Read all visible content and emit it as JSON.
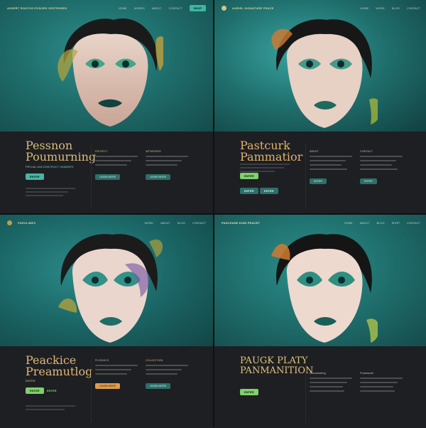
{
  "panels": [
    {
      "nav": {
        "brand": "ASSERT ROUTOS POSORS VESTRORES",
        "links": [
          "HOME",
          "WORKS",
          "ABOUT",
          "CONTACT"
        ],
        "cta": "SHOP"
      },
      "title": "Pessnon Poumurning",
      "subtitle": "PROJAL ANCONSTRUCT HANDRES",
      "button_primary": "ENTER",
      "columns": [
        {
          "heading": "PROJECT",
          "button": "LEARN MORE"
        },
        {
          "heading": "ARTWORKS",
          "button": "LEARN MORE"
        }
      ],
      "colors": {
        "accent": "#49b4a3",
        "gold": "#d8bd7a"
      }
    },
    {
      "nav": {
        "brand": "AURIEL  SIGNATURE  PEACE",
        "links": [
          "HOME",
          "WORK",
          "BLOG",
          "CONTACT"
        ],
        "cta": ""
      },
      "title": "Pastcurk Pammatior",
      "subtitle": "",
      "button_primary": "ENTER",
      "button_secondary": "ENTER",
      "columns": [
        {
          "heading": "ABOUT",
          "button": "ENTER"
        },
        {
          "heading": "CONTACT",
          "button": "ENTER"
        }
      ],
      "colors": {
        "accent": "#49b4a3",
        "gold": "#d8bd7a"
      }
    },
    {
      "nav": {
        "brand": "PAROLIMES",
        "links": [
          "WORK",
          "ABOUT",
          "BLOG",
          "CONTACT"
        ],
        "cta": ""
      },
      "title": "Peackice Preamutlog",
      "subtitle": "ENTER",
      "button_primary": "ENTER",
      "button_secondary": "ENTER",
      "columns": [
        {
          "heading": "PLODNICS",
          "button": "LEARN MORE"
        },
        {
          "heading": "COLLECTION",
          "button": "LEARN MORE"
        }
      ],
      "colors": {
        "accent": "#7fd06e",
        "gold": "#d8bd7a",
        "orange": "#e09a4a"
      }
    },
    {
      "nav": {
        "brand": "PAGLEASE KOIN  PEACET",
        "links": [
          "HOME",
          "ABOUT",
          "BLOG",
          "SHOP",
          "CONTACT"
        ],
        "cta": ""
      },
      "title": "PAUGK PLATY PANMANITION",
      "subtitle": "",
      "button_primary": "ENTER",
      "columns": [
        {
          "heading": "Documenting",
          "button": ""
        },
        {
          "heading": "Framework",
          "button": ""
        }
      ],
      "colors": {
        "accent": "#7fd06e",
        "gold": "#d8bd7a"
      }
    }
  ]
}
